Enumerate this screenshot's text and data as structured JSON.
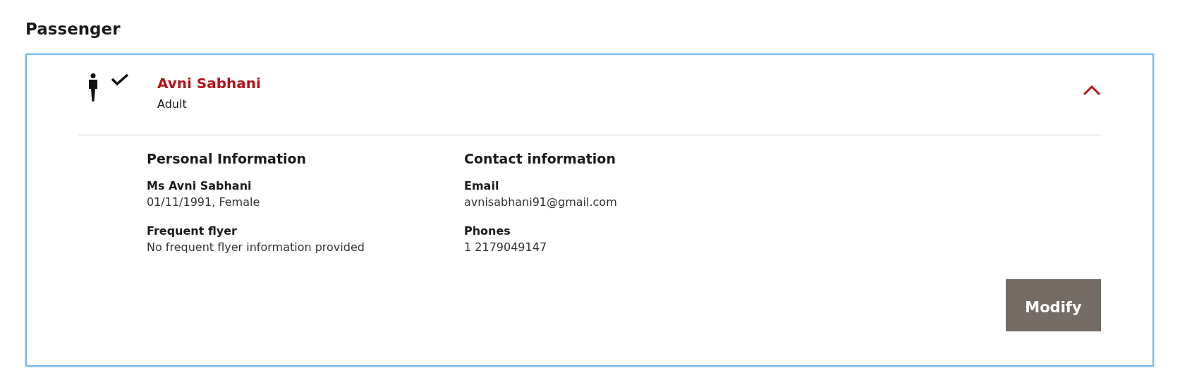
{
  "heading": "Passenger",
  "passenger": {
    "name": "Avni Sabhani",
    "type": "Adult",
    "confirmed": true,
    "expanded": true,
    "sections": [
      {
        "title": "Personal Information",
        "fields": [
          {
            "label": "Ms Avni Sabhani",
            "value": "01/11/1991, Female"
          },
          {
            "label": "Frequent flyer",
            "value": "No frequent flyer information provided"
          }
        ]
      },
      {
        "title": "Contact information",
        "fields": [
          {
            "label": "Email",
            "value": "avnisabhani91@gmail.com"
          },
          {
            "label": "Phones",
            "value": "1 2179049147"
          }
        ]
      }
    ],
    "button": "Modify"
  }
}
